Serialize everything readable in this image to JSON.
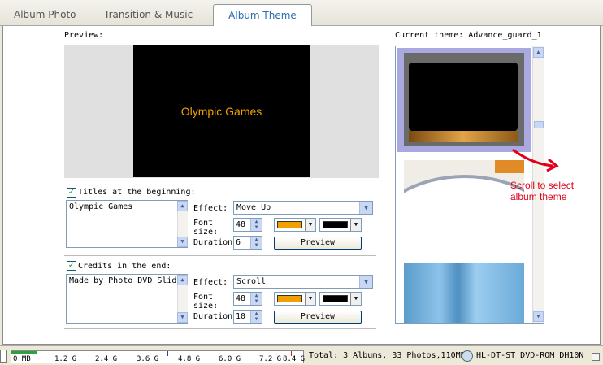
{
  "tabs": [
    {
      "label": "Album Photo"
    },
    {
      "label": "Transition & Music"
    },
    {
      "label": "Album Theme"
    }
  ],
  "preview": {
    "label": "Preview:",
    "screen_text": "Olympic Games"
  },
  "current_theme": {
    "label": "Current theme: Advance_guard_1"
  },
  "titles_section": {
    "checkbox_label": "Titles at the beginning:",
    "checked": true,
    "text": "Olympic Games",
    "effect_label": "Effect:",
    "effect_value": "Move Up",
    "font_size_label_1": "Font",
    "font_size_label_2": "size:",
    "font_size": "48",
    "text_color": "#f0a000",
    "bg_color": "#000000",
    "duration_label": "Duration",
    "duration": "6",
    "preview_button": "Preview"
  },
  "credits_section": {
    "checkbox_label": "Credits in the end:",
    "checked": true,
    "text": "Made by Photo DVD Slides",
    "effect_label": "Effect:",
    "effect_value": "Scroll",
    "font_size_label_1": "Font",
    "font_size_label_2": "size:",
    "font_size": "48",
    "text_color": "#f0a000",
    "bg_color": "#000000",
    "duration_label": "Duration",
    "duration": "10",
    "preview_button": "Preview"
  },
  "annotation": {
    "line1": "Scroll to select",
    "line2": "album theme",
    "color": "#e0001a"
  },
  "ruler": {
    "labels": [
      "0 MB",
      "1.2 G",
      "2.4 G",
      "3.6 G",
      "4.8 G",
      "6.0 G",
      "7.2 G",
      "8.4 G"
    ]
  },
  "status": {
    "total": "Total: 3 Albums, 33 Photos,110MB",
    "drive": "HL-DT-ST DVD-ROM DH10N"
  }
}
